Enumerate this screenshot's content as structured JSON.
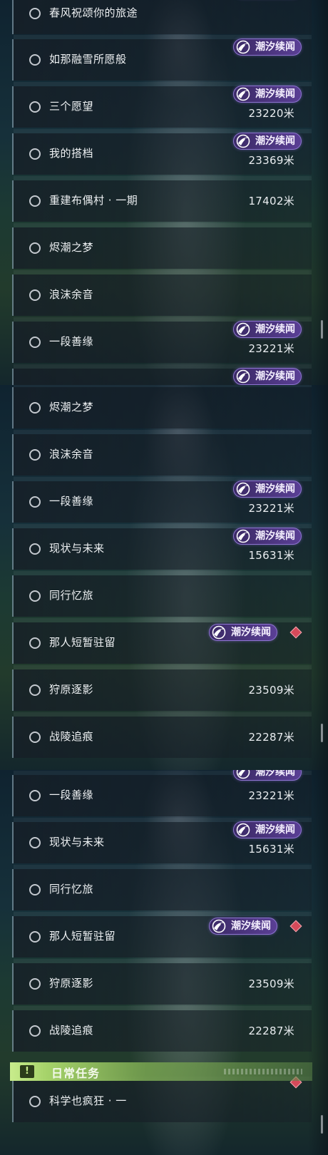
{
  "badge_label": "潮汐续闻",
  "accent_colors": {
    "badge": "#5a3f95",
    "daily_category": "#c8ec8c",
    "marker": "#d64a5a"
  },
  "panels": [
    {
      "rows": [
        {
          "title": "春风祝颂你的旅途"
        },
        {
          "title": "如那融雪所愿般"
        },
        {
          "title": "三个愿望",
          "distance": "23220米"
        },
        {
          "title": "我的搭档",
          "distance": "23369米"
        },
        {
          "title": "重建布偶村 · 一期",
          "distance": "17402米"
        },
        {
          "title": "烬潮之梦"
        },
        {
          "title": "浪沫余音"
        },
        {
          "title": "一段善缘",
          "distance": "23221米"
        }
      ]
    },
    {
      "rows": [
        {
          "title": "烬潮之梦"
        },
        {
          "title": "浪沫余音"
        },
        {
          "title": "一段善缘",
          "distance": "23221米"
        },
        {
          "title": "现状与未来",
          "distance": "15631米"
        },
        {
          "title": "同行忆旅"
        },
        {
          "title": "那人短暂驻留"
        },
        {
          "title": "狩原逐影",
          "distance": "23509米"
        },
        {
          "title": "战陵追痕",
          "distance": "22287米"
        }
      ]
    },
    {
      "rows": [
        {
          "title": "一段善缘",
          "distance": "23221米"
        },
        {
          "title": "现状与未来",
          "distance": "15631米"
        },
        {
          "title": "同行忆旅"
        },
        {
          "title": "那人短暂驻留"
        },
        {
          "title": "狩原逐影",
          "distance": "23509米"
        },
        {
          "title": "战陵追痕",
          "distance": "22287米"
        }
      ],
      "category": {
        "icon": "!",
        "title": "日常任务"
      },
      "daily_rows": [
        {
          "title": "科学也疯狂 · 一"
        }
      ]
    }
  ]
}
